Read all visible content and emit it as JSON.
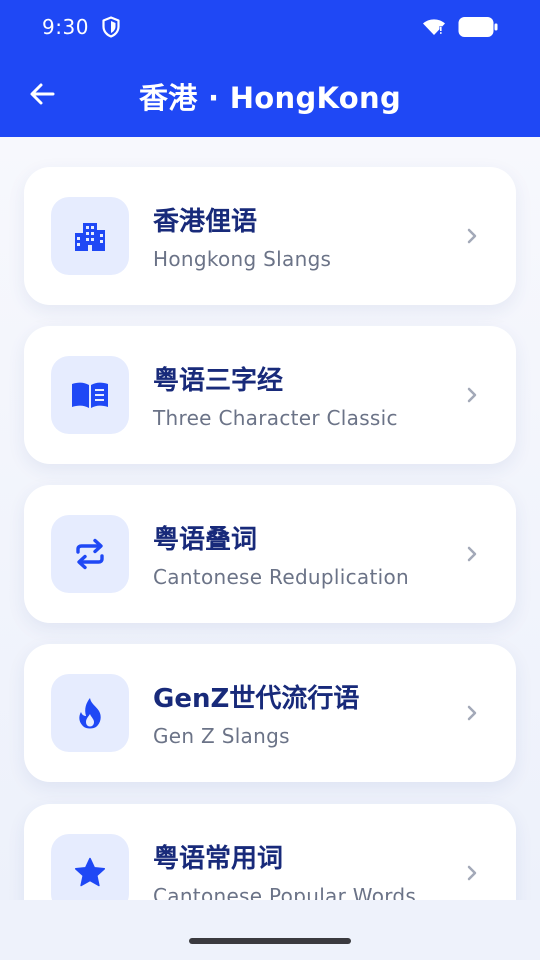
{
  "status_bar": {
    "time": "9:30"
  },
  "header": {
    "title": "香港 · HongKong"
  },
  "colors": {
    "primary": "#1f48f5",
    "icon_bg": "#e6ecfe",
    "title_text": "#182a7a",
    "subtitle_text": "#6b7387"
  },
  "categories": [
    {
      "title": "香港俚语",
      "subtitle": "Hongkong Slangs",
      "icon": "city-buildings-icon"
    },
    {
      "title": "粤语三字经",
      "subtitle": "Three Character Classic",
      "icon": "open-book-icon"
    },
    {
      "title": "粤语叠词",
      "subtitle": "Cantonese Reduplication",
      "icon": "repeat-arrows-icon"
    },
    {
      "title": "GenZ世代流行语",
      "subtitle": "Gen Z Slangs",
      "icon": "flame-icon"
    },
    {
      "title": "粤语常用词",
      "subtitle": "Cantonese Popular Words",
      "icon": "star-icon"
    }
  ]
}
